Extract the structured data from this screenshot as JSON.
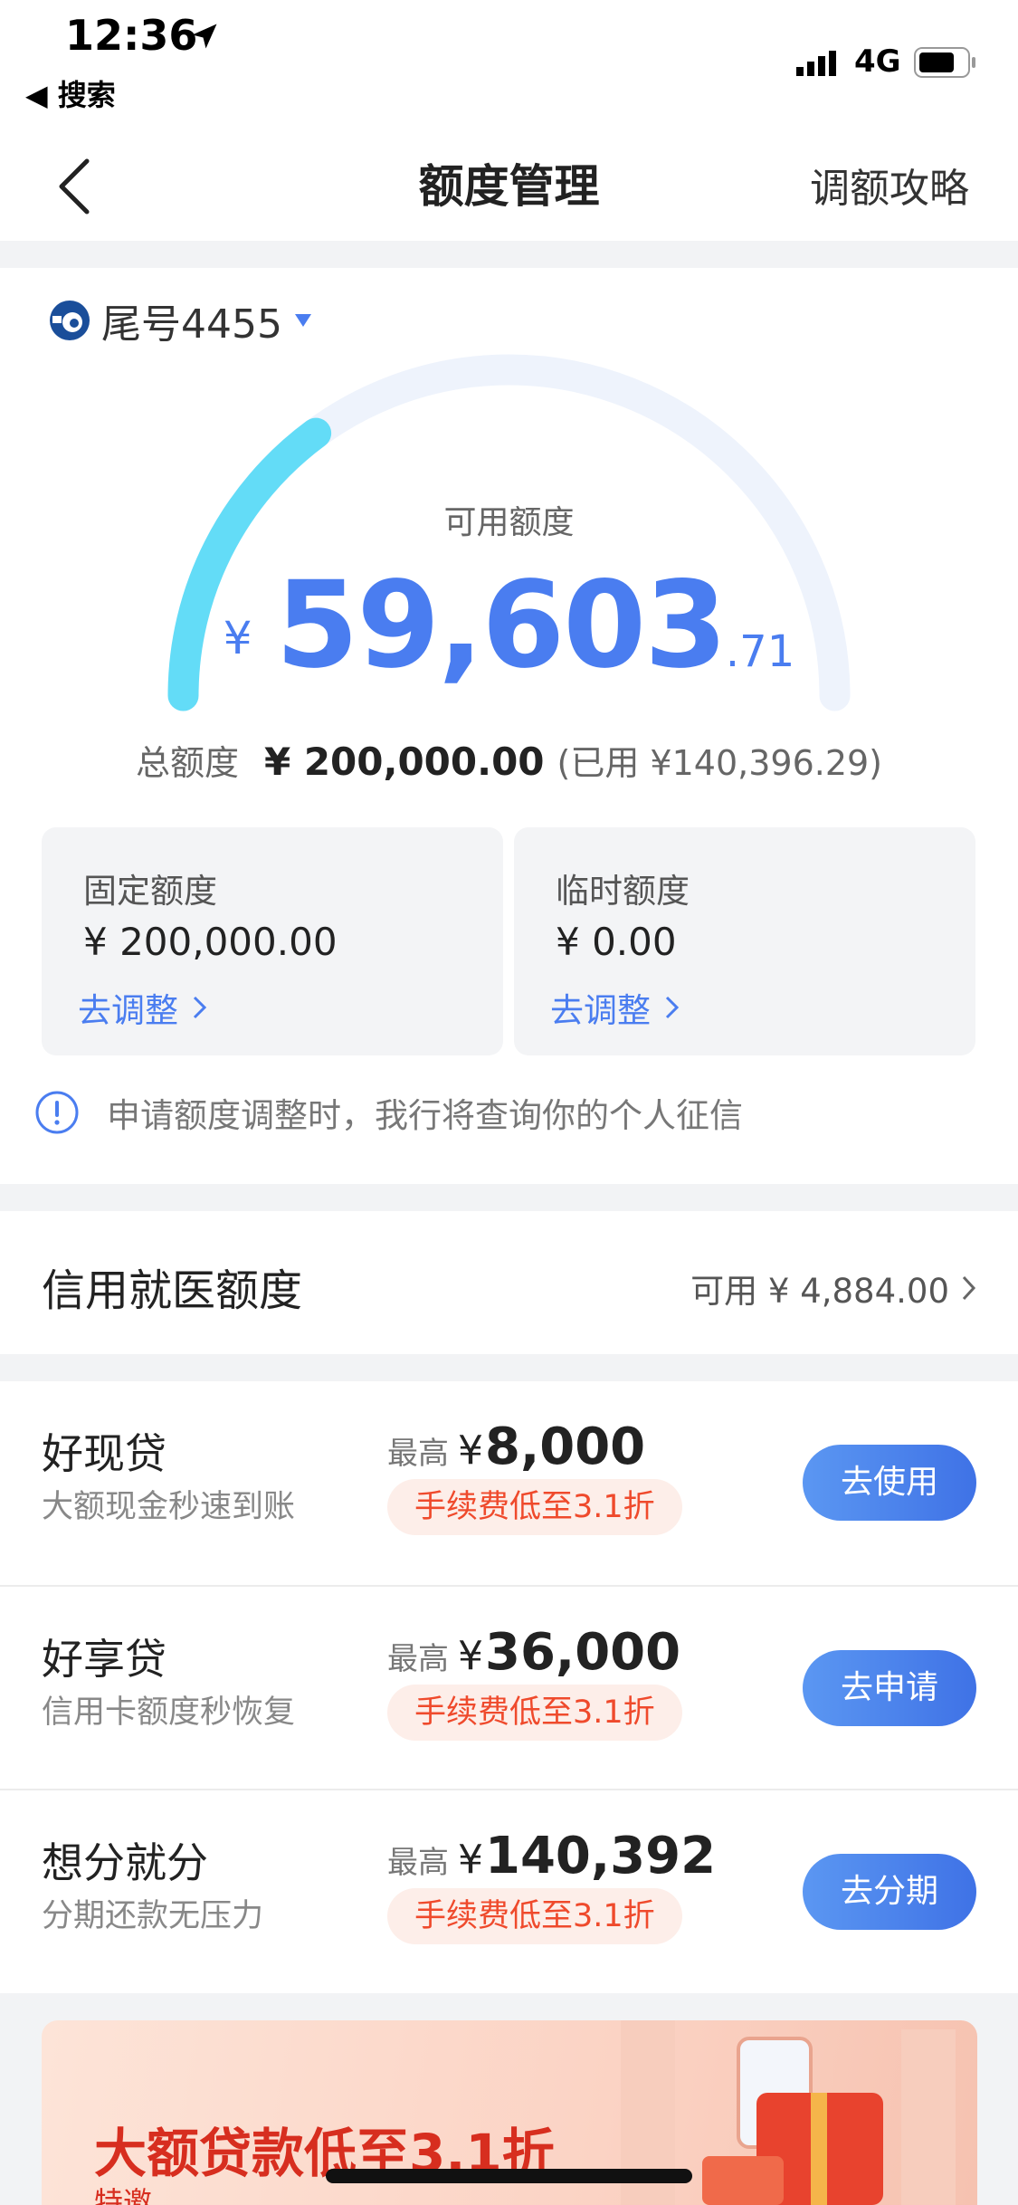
{
  "status_bar": {
    "time": "12:36",
    "back_app": "◀ 搜索",
    "network": "4G"
  },
  "nav": {
    "title": "额度管理",
    "right_action": "调额攻略"
  },
  "card": {
    "label": "尾号4455"
  },
  "gauge": {
    "label": "可用额度",
    "currency": "¥",
    "amount_int": "59,603",
    "amount_dec": ".71",
    "available": 59603.71,
    "total_value": 200000.0
  },
  "total": {
    "label": "总额度",
    "value": "¥ 200,000.00",
    "used": "(已用 ¥140,396.29)"
  },
  "quotas": [
    {
      "title": "固定额度",
      "amount": "¥ 200,000.00",
      "link": "去调整"
    },
    {
      "title": "临时额度",
      "amount": "¥ 0.00",
      "link": "去调整"
    }
  ],
  "notice": {
    "text": "申请额度调整时，我行将查询你的个人征信"
  },
  "medical": {
    "title": "信用就医额度",
    "right": "可用 ¥ 4,884.00"
  },
  "loans": [
    {
      "name": "好现贷",
      "desc": "大额现金秒速到账",
      "max_label": "最高",
      "currency": "¥",
      "max_value": "8,000",
      "fee": "手续费低至3.1折",
      "button": "去使用"
    },
    {
      "name": "好享贷",
      "desc": "信用卡额度秒恢复",
      "max_label": "最高",
      "currency": "¥",
      "max_value": "36,000",
      "fee": "手续费低至3.1折",
      "button": "去申请"
    },
    {
      "name": "想分就分",
      "desc": "分期还款无压力",
      "max_label": "最高",
      "currency": "¥",
      "max_value": "140,392",
      "fee": "手续费低至3.1折",
      "button": "去分期"
    }
  ],
  "banner": {
    "title": "大额贷款低至3.1折",
    "subtitle": "特邀"
  },
  "colors": {
    "accent": "#4a7df0",
    "gauge_fill": "#63dcf7",
    "gauge_track": "#eef3fc",
    "fee_red": "#ef4a2c"
  }
}
